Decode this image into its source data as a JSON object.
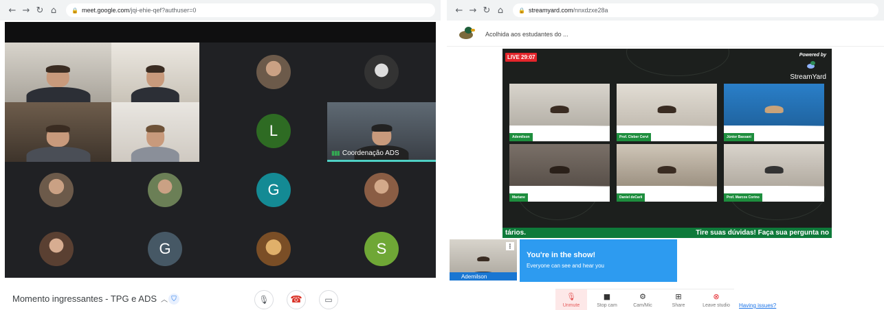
{
  "meet": {
    "url_host": "meet.google.com",
    "url_path": "/jqi-ehie-qef?authuser=0",
    "speaker_name": "Coordenação ADS",
    "meeting_title": "Momento ingressantes - TPG e ADS",
    "avatars": [
      {
        "letter": "L",
        "color": "#2e6b23"
      },
      {
        "letter": "G",
        "color": "#148a94"
      },
      {
        "letter": "G",
        "color": "#465865"
      },
      {
        "letter": "S",
        "color": "#6fa736"
      }
    ]
  },
  "streamyard": {
    "url_host": "streamyard.com",
    "url_path": "/nnxdzxe28a",
    "broadcast_title": "Acolhida aos estudantes do ...",
    "live_badge": "LIVE 29:07",
    "powered_by": "Powered by",
    "brand": "StreamYard",
    "participants": [
      "Ademilson",
      "Prof. Cleber Cervi",
      "Júnior Bassani",
      "Mariane",
      "Daniel deCarli",
      "Prof. Marcos Corino"
    ],
    "ticker_left": "tários.",
    "ticker_right": "Tire suas dúvidas! Faça sua pergunta no",
    "self_name": "Ademilson",
    "toast_title": "You're in the show!",
    "toast_subtitle": "Everyone can see and hear you",
    "toolbar": {
      "unmute": "Unmute",
      "stop_cam": "Stop cam",
      "cam_mic": "Cam/Mic",
      "share": "Share",
      "leave": "Leave studio"
    },
    "having_issues": "Having issues?"
  }
}
